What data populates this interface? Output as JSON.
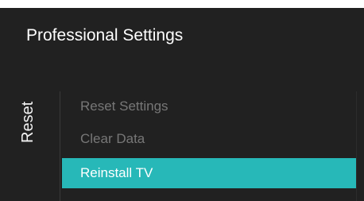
{
  "header": {
    "title": "Professional Settings"
  },
  "side_label": "Reset",
  "menu": {
    "items": [
      {
        "label": "Reset Settings",
        "state": "disabled"
      },
      {
        "label": "Clear Data",
        "state": "disabled"
      },
      {
        "label": "Reinstall TV",
        "state": "selected"
      }
    ]
  },
  "colors": {
    "background": "#212121",
    "highlight": "#27b8b8",
    "text_primary": "#ffffff",
    "text_disabled": "#777777"
  }
}
